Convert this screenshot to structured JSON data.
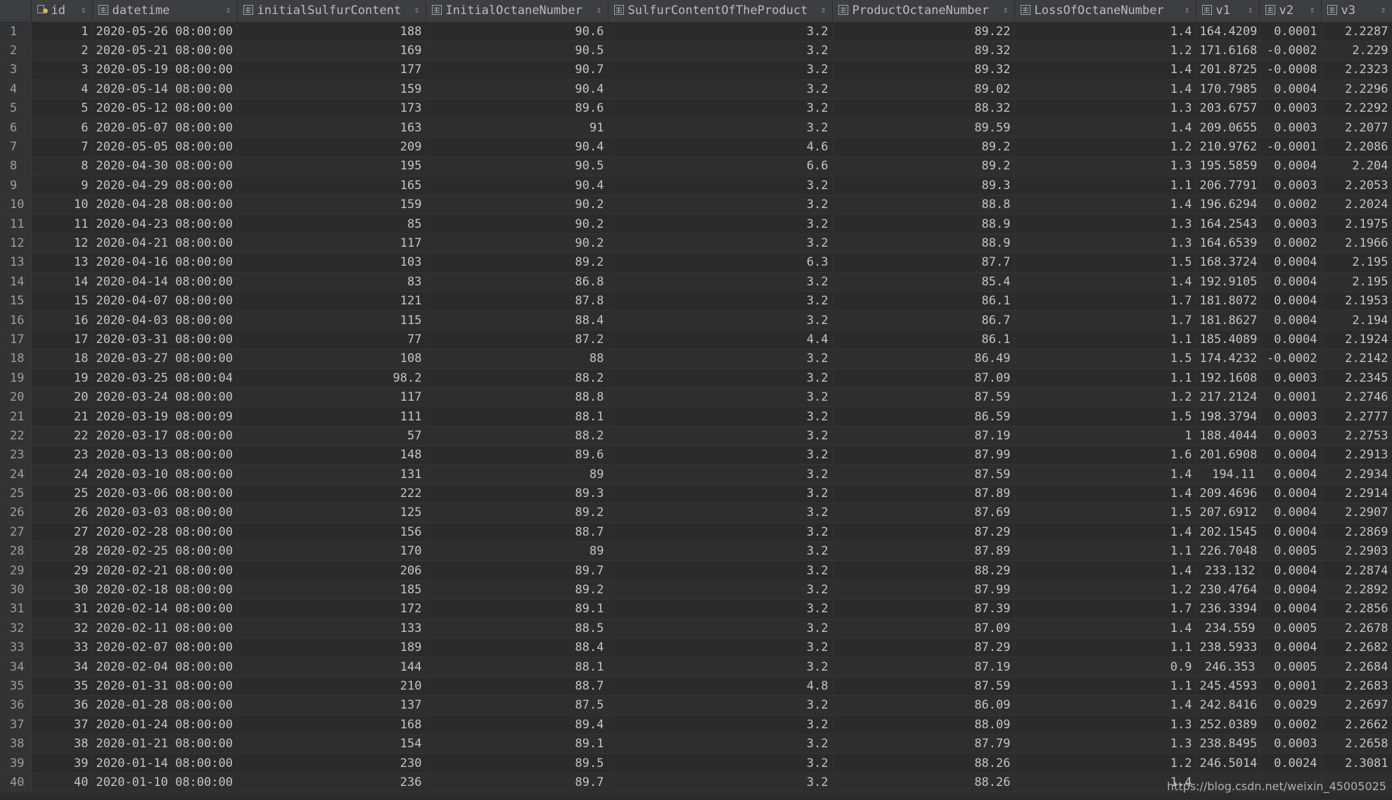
{
  "columns": [
    {
      "label": "",
      "icon": "none"
    },
    {
      "label": "id",
      "icon": "key-column-icon"
    },
    {
      "label": "datetime",
      "icon": "table-column-icon"
    },
    {
      "label": "initialSulfurContent",
      "icon": "table-column-icon"
    },
    {
      "label": "InitialOctaneNumber",
      "icon": "table-column-icon"
    },
    {
      "label": "SulfurContentOfTheProduct",
      "icon": "table-column-icon"
    },
    {
      "label": "ProductOctaneNumber",
      "icon": "table-column-icon"
    },
    {
      "label": "LossOfOctaneNumber",
      "icon": "table-column-icon"
    },
    {
      "label": "v1",
      "icon": "table-column-icon"
    },
    {
      "label": "v2",
      "icon": "table-column-icon"
    },
    {
      "label": "v3",
      "icon": "table-column-icon"
    }
  ],
  "sort_glyph": "⇕",
  "rows": [
    [
      "1",
      "1",
      "2020-05-26 08:00:00",
      "188",
      "90.6",
      "3.2",
      "89.22",
      "1.4",
      "164.4209",
      "0.0001",
      "2.2287"
    ],
    [
      "2",
      "2",
      "2020-05-21 08:00:00",
      "169",
      "90.5",
      "3.2",
      "89.32",
      "1.2",
      "171.6168",
      "-0.0002",
      "2.229"
    ],
    [
      "3",
      "3",
      "2020-05-19 08:00:00",
      "177",
      "90.7",
      "3.2",
      "89.32",
      "1.4",
      "201.8725",
      "-0.0008",
      "2.2323"
    ],
    [
      "4",
      "4",
      "2020-05-14 08:00:00",
      "159",
      "90.4",
      "3.2",
      "89.02",
      "1.4",
      "170.7985",
      "0.0004",
      "2.2296"
    ],
    [
      "5",
      "5",
      "2020-05-12 08:00:00",
      "173",
      "89.6",
      "3.2",
      "88.32",
      "1.3",
      "203.6757",
      "0.0003",
      "2.2292"
    ],
    [
      "6",
      "6",
      "2020-05-07 08:00:00",
      "163",
      "91",
      "3.2",
      "89.59",
      "1.4",
      "209.0655",
      "0.0003",
      "2.2077"
    ],
    [
      "7",
      "7",
      "2020-05-05 08:00:00",
      "209",
      "90.4",
      "4.6",
      "89.2",
      "1.2",
      "210.9762",
      "-0.0001",
      "2.2086"
    ],
    [
      "8",
      "8",
      "2020-04-30 08:00:00",
      "195",
      "90.5",
      "6.6",
      "89.2",
      "1.3",
      "195.5859",
      "0.0004",
      "2.204"
    ],
    [
      "9",
      "9",
      "2020-04-29 08:00:00",
      "165",
      "90.4",
      "3.2",
      "89.3",
      "1.1",
      "206.7791",
      "0.0003",
      "2.2053"
    ],
    [
      "10",
      "10",
      "2020-04-28 08:00:00",
      "159",
      "90.2",
      "3.2",
      "88.8",
      "1.4",
      "196.6294",
      "0.0002",
      "2.2024"
    ],
    [
      "11",
      "11",
      "2020-04-23 08:00:00",
      "85",
      "90.2",
      "3.2",
      "88.9",
      "1.3",
      "164.2543",
      "0.0003",
      "2.1975"
    ],
    [
      "12",
      "12",
      "2020-04-21 08:00:00",
      "117",
      "90.2",
      "3.2",
      "88.9",
      "1.3",
      "164.6539",
      "0.0002",
      "2.1966"
    ],
    [
      "13",
      "13",
      "2020-04-16 08:00:00",
      "103",
      "89.2",
      "6.3",
      "87.7",
      "1.5",
      "168.3724",
      "0.0004",
      "2.195"
    ],
    [
      "14",
      "14",
      "2020-04-14 08:00:00",
      "83",
      "86.8",
      "3.2",
      "85.4",
      "1.4",
      "192.9105",
      "0.0004",
      "2.195"
    ],
    [
      "15",
      "15",
      "2020-04-07 08:00:00",
      "121",
      "87.8",
      "3.2",
      "86.1",
      "1.7",
      "181.8072",
      "0.0004",
      "2.1953"
    ],
    [
      "16",
      "16",
      "2020-04-03 08:00:00",
      "115",
      "88.4",
      "3.2",
      "86.7",
      "1.7",
      "181.8627",
      "0.0004",
      "2.194"
    ],
    [
      "17",
      "17",
      "2020-03-31 08:00:00",
      "77",
      "87.2",
      "4.4",
      "86.1",
      "1.1",
      "185.4089",
      "0.0004",
      "2.1924"
    ],
    [
      "18",
      "18",
      "2020-03-27 08:00:00",
      "108",
      "88",
      "3.2",
      "86.49",
      "1.5",
      "174.4232",
      "-0.0002",
      "2.2142"
    ],
    [
      "19",
      "19",
      "2020-03-25 08:00:04",
      "98.2",
      "88.2",
      "3.2",
      "87.09",
      "1.1",
      "192.1608",
      "0.0003",
      "2.2345"
    ],
    [
      "20",
      "20",
      "2020-03-24 08:00:00",
      "117",
      "88.8",
      "3.2",
      "87.59",
      "1.2",
      "217.2124",
      "0.0001",
      "2.2746"
    ],
    [
      "21",
      "21",
      "2020-03-19 08:00:09",
      "111",
      "88.1",
      "3.2",
      "86.59",
      "1.5",
      "198.3794",
      "0.0003",
      "2.2777"
    ],
    [
      "22",
      "22",
      "2020-03-17 08:00:00",
      "57",
      "88.2",
      "3.2",
      "87.19",
      "1",
      "188.4044",
      "0.0003",
      "2.2753"
    ],
    [
      "23",
      "23",
      "2020-03-13 08:00:00",
      "148",
      "89.6",
      "3.2",
      "87.99",
      "1.6",
      "201.6908",
      "0.0004",
      "2.2913"
    ],
    [
      "24",
      "24",
      "2020-03-10 08:00:00",
      "131",
      "89",
      "3.2",
      "87.59",
      "1.4",
      "194.11",
      "0.0004",
      "2.2934"
    ],
    [
      "25",
      "25",
      "2020-03-06 08:00:00",
      "222",
      "89.3",
      "3.2",
      "87.89",
      "1.4",
      "209.4696",
      "0.0004",
      "2.2914"
    ],
    [
      "26",
      "26",
      "2020-03-03 08:00:00",
      "125",
      "89.2",
      "3.2",
      "87.69",
      "1.5",
      "207.6912",
      "0.0004",
      "2.2907"
    ],
    [
      "27",
      "27",
      "2020-02-28 08:00:00",
      "156",
      "88.7",
      "3.2",
      "87.29",
      "1.4",
      "202.1545",
      "0.0004",
      "2.2869"
    ],
    [
      "28",
      "28",
      "2020-02-25 08:00:00",
      "170",
      "89",
      "3.2",
      "87.89",
      "1.1",
      "226.7048",
      "0.0005",
      "2.2903"
    ],
    [
      "29",
      "29",
      "2020-02-21 08:00:00",
      "206",
      "89.7",
      "3.2",
      "88.29",
      "1.4",
      "233.132",
      "0.0004",
      "2.2874"
    ],
    [
      "30",
      "30",
      "2020-02-18 08:00:00",
      "185",
      "89.2",
      "3.2",
      "87.99",
      "1.2",
      "230.4764",
      "0.0004",
      "2.2892"
    ],
    [
      "31",
      "31",
      "2020-02-14 08:00:00",
      "172",
      "89.1",
      "3.2",
      "87.39",
      "1.7",
      "236.3394",
      "0.0004",
      "2.2856"
    ],
    [
      "32",
      "32",
      "2020-02-11 08:00:00",
      "133",
      "88.5",
      "3.2",
      "87.09",
      "1.4",
      "234.559",
      "0.0005",
      "2.2678"
    ],
    [
      "33",
      "33",
      "2020-02-07 08:00:00",
      "189",
      "88.4",
      "3.2",
      "87.29",
      "1.1",
      "238.5933",
      "0.0004",
      "2.2682"
    ],
    [
      "34",
      "34",
      "2020-02-04 08:00:00",
      "144",
      "88.1",
      "3.2",
      "87.19",
      "0.9",
      "246.353",
      "0.0005",
      "2.2684"
    ],
    [
      "35",
      "35",
      "2020-01-31 08:00:00",
      "210",
      "88.7",
      "4.8",
      "87.59",
      "1.1",
      "245.4593",
      "0.0001",
      "2.2683"
    ],
    [
      "36",
      "36",
      "2020-01-28 08:00:00",
      "137",
      "87.5",
      "3.2",
      "86.09",
      "1.4",
      "242.8416",
      "0.0029",
      "2.2697"
    ],
    [
      "37",
      "37",
      "2020-01-24 08:00:00",
      "168",
      "89.4",
      "3.2",
      "88.09",
      "1.3",
      "252.0389",
      "0.0002",
      "2.2662"
    ],
    [
      "38",
      "38",
      "2020-01-21 08:00:00",
      "154",
      "89.1",
      "3.2",
      "87.79",
      "1.3",
      "238.8495",
      "0.0003",
      "2.2658"
    ],
    [
      "39",
      "39",
      "2020-01-14 08:00:00",
      "230",
      "89.5",
      "3.2",
      "88.26",
      "1.2",
      "246.5014",
      "0.0024",
      "2.3081"
    ],
    [
      "40",
      "40",
      "2020-01-10 08:00:00",
      "236",
      "89.7",
      "3.2",
      "88.26",
      "1.4",
      "",
      "",
      ""
    ]
  ],
  "watermark": "https://blog.csdn.net/weixin_45005025"
}
